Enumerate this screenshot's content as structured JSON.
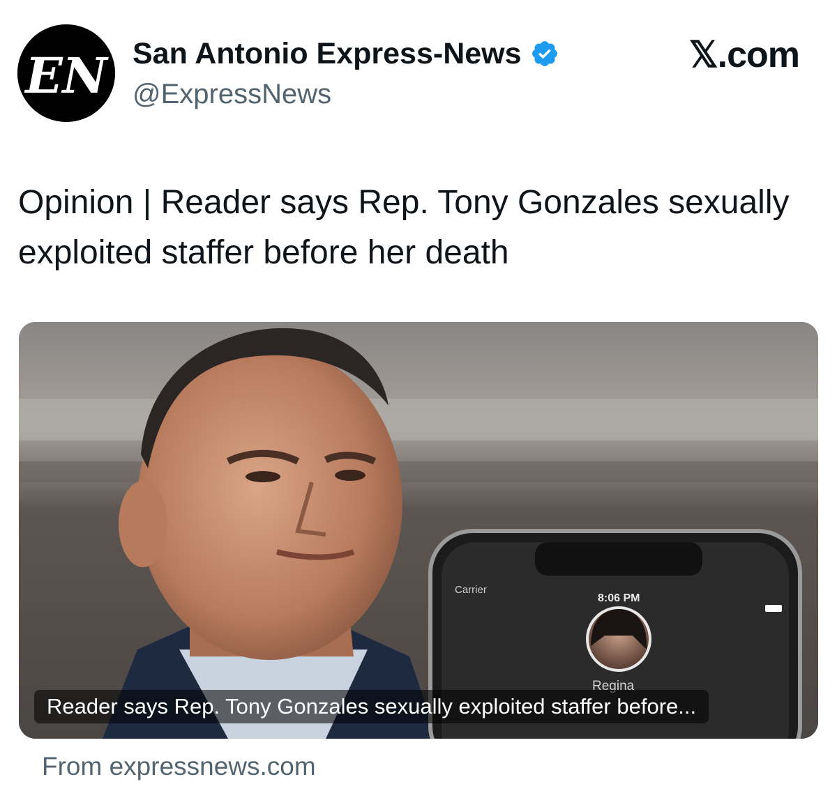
{
  "author": {
    "display_name": "San Antonio Express-News",
    "handle": "@ExpressNews",
    "avatar_text": "EN"
  },
  "site_label": "𝕏.com",
  "tweet": {
    "text": "Opinion | Reader says Rep. Tony Gonzales sexually exploited staffer before her death"
  },
  "card": {
    "caption": "Reader says Rep. Tony Gonzales sexually exploited staffer before...",
    "phone": {
      "carrier": "Carrier",
      "time": "8:06 PM",
      "contact_name": "Regina"
    },
    "source": "From expressnews.com"
  },
  "colors": {
    "verified_badge": "#1d9bf0",
    "secondary_text": "#536471",
    "primary_text": "#0f1419"
  }
}
